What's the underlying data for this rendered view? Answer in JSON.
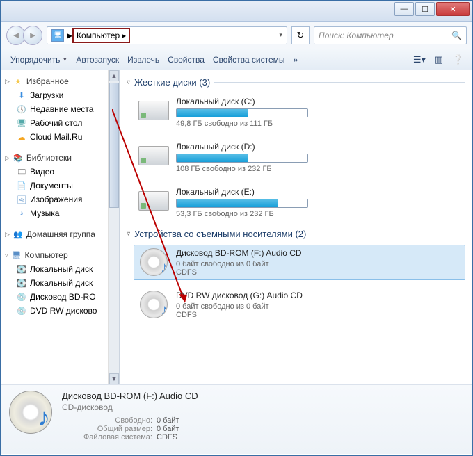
{
  "window_controls": {
    "min": "—",
    "max": "☐",
    "close": "✕"
  },
  "address": {
    "location": "Компьютер",
    "search_placeholder": "Поиск: Компьютер"
  },
  "toolbar": {
    "organize": "Упорядочить",
    "autostart": "Автозапуск",
    "extract": "Извлечь",
    "properties": "Свойства",
    "sys_properties": "Свойства системы",
    "overflow": "»"
  },
  "sidebar": {
    "favorites": {
      "label": "Избранное",
      "items": [
        {
          "icon": "⬇",
          "label": "Загрузки",
          "color": "#3a8de0"
        },
        {
          "icon": "🕓",
          "label": "Недавние места",
          "color": "#c77"
        },
        {
          "icon": "🖥",
          "label": "Рабочий стол",
          "color": "#5aa"
        },
        {
          "icon": "☁",
          "label": "Cloud Mail.Ru",
          "color": "#f5a623"
        }
      ]
    },
    "libraries": {
      "label": "Библиотеки",
      "items": [
        {
          "icon": "🎞",
          "label": "Видео",
          "color": "#666"
        },
        {
          "icon": "📄",
          "label": "Документы",
          "color": "#6a8"
        },
        {
          "icon": "🖼",
          "label": "Изображения",
          "color": "#69c"
        },
        {
          "icon": "♪",
          "label": "Музыка",
          "color": "#2f7dd2"
        }
      ]
    },
    "homegroup": {
      "icon": "👥",
      "label": "Домашняя группа"
    },
    "computer": {
      "label": "Компьютер",
      "items": [
        {
          "icon": "💽",
          "label": "Локальный диск"
        },
        {
          "icon": "💽",
          "label": "Локальный диск"
        },
        {
          "icon": "💿",
          "label": "Дисковод BD-RO"
        },
        {
          "icon": "💿",
          "label": "DVD RW дисково"
        }
      ]
    }
  },
  "main": {
    "cat_hdd": "Жесткие диски (3)",
    "drives_hdd": [
      {
        "title": "Локальный диск (C:)",
        "sub": "49,8 ГБ свободно из 111 ГБ",
        "fill": 55
      },
      {
        "title": "Локальный диск (D:)",
        "sub": "108 ГБ свободно из 232 ГБ",
        "fill": 54
      },
      {
        "title": "Локальный диск (E:)",
        "sub": "53,3 ГБ свободно из 232 ГБ",
        "fill": 77
      }
    ],
    "cat_removable": "Устройства со съемными носителями (2)",
    "drives_removable": [
      {
        "title": "Дисковод BD-ROM (F:) Audio CD",
        "sub": "0 байт свободно из 0 байт",
        "fs": "CDFS",
        "selected": true
      },
      {
        "title": "DVD RW дисковод (G:) Audio CD",
        "sub": "0 байт свободно из 0 байт",
        "fs": "CDFS",
        "selected": false
      }
    ]
  },
  "details": {
    "title": "Дисковод BD-ROM (F:) Audio CD",
    "type": "CD-дисковод",
    "rows": [
      {
        "label": "Свободно:",
        "value": "0 байт"
      },
      {
        "label": "Общий размер:",
        "value": "0 байт"
      },
      {
        "label": "Файловая система:",
        "value": "CDFS"
      }
    ]
  }
}
